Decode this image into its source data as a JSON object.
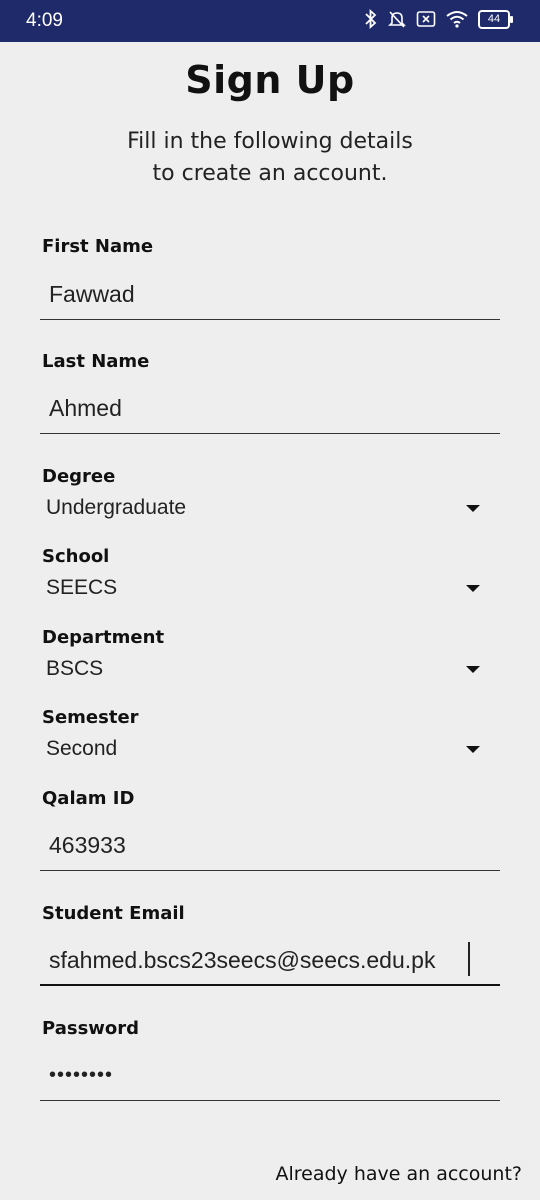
{
  "status_bar": {
    "time": "4:09",
    "battery": "44"
  },
  "header": {
    "title": "Sign Up",
    "subtitle_line1": "Fill in the following details",
    "subtitle_line2": "to create an account."
  },
  "form": {
    "first_name": {
      "label": "First Name",
      "value": "Fawwad"
    },
    "last_name": {
      "label": "Last Name",
      "value": "Ahmed"
    },
    "degree": {
      "label": "Degree",
      "value": "Undergraduate"
    },
    "school": {
      "label": "School",
      "value": "SEECS"
    },
    "department": {
      "label": "Department",
      "value": "BSCS"
    },
    "semester": {
      "label": "Semester",
      "value": "Second"
    },
    "qalam_id": {
      "label": "Qalam ID",
      "value": "463933"
    },
    "student_email": {
      "label": "Student Email",
      "value": "sfahmed.bscs23seecs@seecs.edu.pk"
    },
    "password": {
      "label": "Password",
      "value": "password"
    }
  },
  "footer": {
    "login_link": "Already have an account?"
  }
}
